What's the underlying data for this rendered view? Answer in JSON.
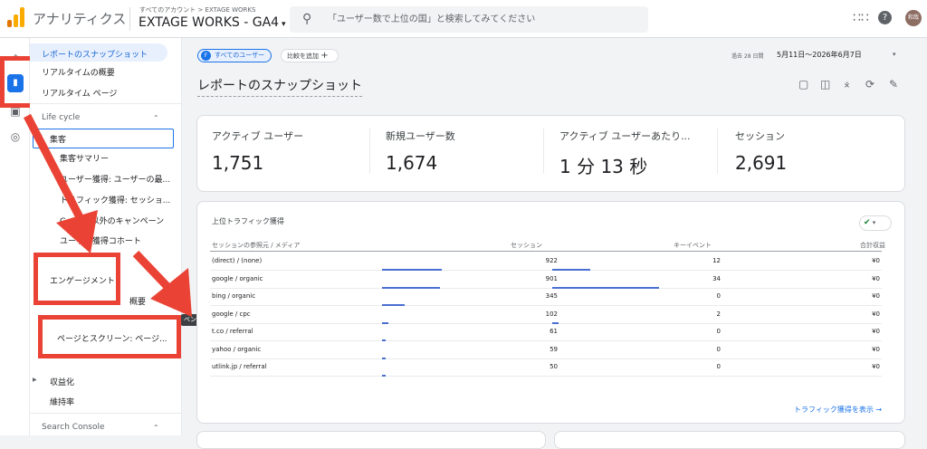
{
  "topbar": {
    "app_name": "アナリティクス",
    "account_crumb": "すべてのアカウント > EXTAGE WORKS",
    "property": "EXTAGE WORKS - GA4",
    "search_placeholder": "「ユーザー数で上位の国」と検索してみてください",
    "avatar_text": "和哉"
  },
  "sidebar": {
    "top_items": [
      "レポートのスナップショット",
      "リアルタイムの概要",
      "リアルタイム ページ"
    ],
    "lifecycle_label": "Life cycle",
    "acquisition_label": "集客",
    "acq_items": [
      "集客サマリー",
      "ユーザー獲得: ユーザーの最...",
      "トラフィック獲得: セッショ...",
      "Google 以外のキャンペーン",
      "ユーザー獲得コホート"
    ],
    "engagement_label": "エンゲージメント",
    "engagement_overview_partial": "概要",
    "pages_label": "ページとスクリーン: ページ...",
    "tooltip": "ベント",
    "monetization_label": "収益化",
    "retention_label": "維持率",
    "search_console_label": "Search Console"
  },
  "main": {
    "chip_users": "すべてのユーザー",
    "chip_users_badge": "F",
    "chip_add": "比較を追加",
    "date_label": "過去 28 日間",
    "date_range": "5月11日～2026年6月7日",
    "title": "レポートのスナップショット",
    "metrics": [
      {
        "label": "アクティブ ユーザー",
        "value": "1,751"
      },
      {
        "label": "新規ユーザー数",
        "value": "1,674"
      },
      {
        "label": "アクティブ ユーザーあたり...",
        "value": "1 分 13 秒"
      },
      {
        "label": "セッション",
        "value": "2,691"
      }
    ],
    "table": {
      "title": "上位トラフィック獲得",
      "headers": [
        "セッションの参照元 / メディア",
        "セッション",
        "キーイベント",
        "合計収益"
      ],
      "rows": [
        {
          "source": "(direct) / (none)",
          "sessions": "922",
          "events": "12",
          "revenue": "¥0",
          "s": 922,
          "e": 12
        },
        {
          "source": "google / organic",
          "sessions": "901",
          "events": "34",
          "revenue": "¥0",
          "s": 901,
          "e": 34
        },
        {
          "source": "bing / organic",
          "sessions": "345",
          "events": "0",
          "revenue": "¥0",
          "s": 345,
          "e": 0
        },
        {
          "source": "google / cpc",
          "sessions": "102",
          "events": "2",
          "revenue": "¥0",
          "s": 102,
          "e": 2
        },
        {
          "source": "t.co / referral",
          "sessions": "61",
          "events": "0",
          "revenue": "¥0",
          "s": 61,
          "e": 0
        },
        {
          "source": "yahoo / organic",
          "sessions": "59",
          "events": "0",
          "revenue": "¥0",
          "s": 59,
          "e": 0
        },
        {
          "source": "utlink.jp / referral",
          "sessions": "50",
          "events": "0",
          "revenue": "¥0",
          "s": 50,
          "e": 0
        }
      ],
      "link": "トラフィック獲得を表示"
    }
  },
  "colors": {
    "accent": "#1a73e8",
    "annotation_red": "#ea4335",
    "bar": "#4a6fd1"
  }
}
